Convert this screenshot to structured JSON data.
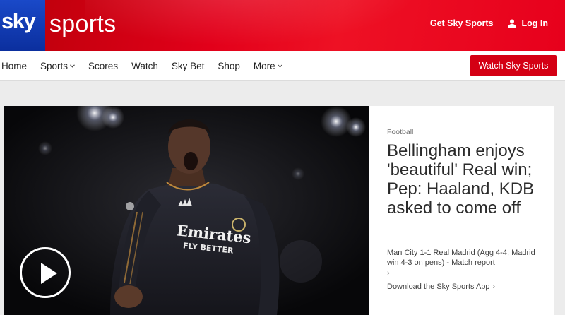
{
  "brand": {
    "sky": "sky",
    "sports": "sports"
  },
  "header": {
    "get_sky_sports": "Get Sky Sports",
    "login": "Log In"
  },
  "nav": {
    "items": [
      {
        "label": "Home",
        "dropdown": false
      },
      {
        "label": "Sports",
        "dropdown": true
      },
      {
        "label": "Scores",
        "dropdown": false
      },
      {
        "label": "Watch",
        "dropdown": false
      },
      {
        "label": "Sky Bet",
        "dropdown": false
      },
      {
        "label": "Shop",
        "dropdown": false
      },
      {
        "label": "More",
        "dropdown": true
      }
    ],
    "cta": "Watch Sky Sports"
  },
  "hero": {
    "category": "Football",
    "headline": "Bellingham enjoys 'beautiful' Real win; Pep: Haaland, KDB asked to come off",
    "related": "Man City 1-1 Real Madrid (Agg 4-4, Madrid win 4-3 on pens) - Match report",
    "download": "Download the Sky Sports App",
    "shirt_text": {
      "sponsor": "Emirates",
      "slogan": "FLY BETTER"
    },
    "media_icon": "play-icon"
  },
  "colors": {
    "brand_red": "#e2001a",
    "brand_blue": "#0b2f9e",
    "cta_red": "#d40014"
  }
}
